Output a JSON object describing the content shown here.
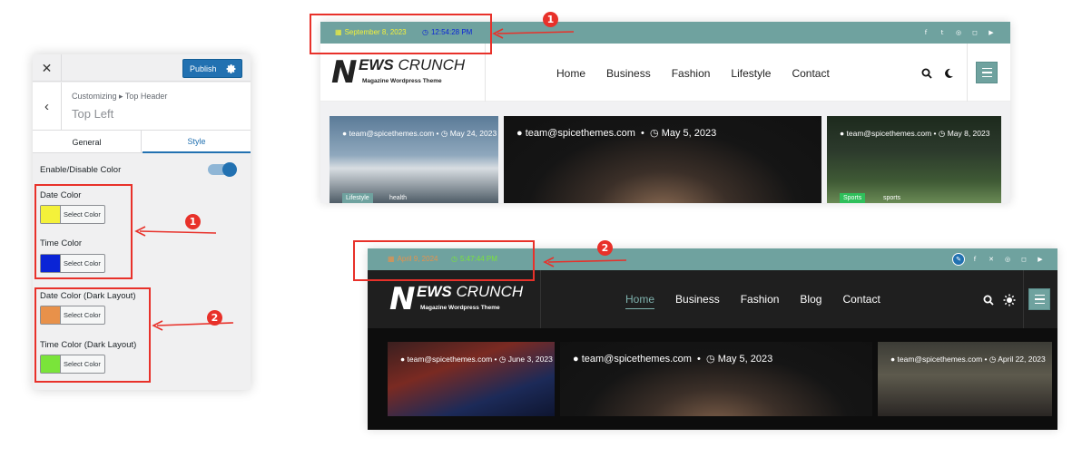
{
  "customizer": {
    "close_icon": "close-icon",
    "publish_label": "Publish",
    "settings_icon": "gear-icon",
    "back_icon": "chevron-left-icon",
    "breadcrumb": "Customizing ▸ Top Header",
    "section_title": "Top Left",
    "tabs": [
      "General",
      "Style"
    ],
    "enable_label": "Enable/Disable Color",
    "enable_on": true,
    "fields": [
      {
        "label": "Date Color",
        "color": "#f4f13a",
        "button": "Select Color"
      },
      {
        "label": "Time Color",
        "color": "#0a24d6",
        "button": "Select Color"
      },
      {
        "label": "Date Color (Dark Layout)",
        "color": "#e8914a",
        "button": "Select Color"
      },
      {
        "label": "Time Color (Dark Layout)",
        "color": "#7ae43a",
        "button": "Select Color"
      }
    ]
  },
  "callouts": {
    "one": "1",
    "two": "2",
    "accent": "#e8312a"
  },
  "light_site": {
    "date": "September 8, 2023",
    "time": "12:54:28 PM",
    "date_color": "#f4f13a",
    "time_color": "#0a24d6",
    "strip_color": "#6fa29f",
    "social_icons": [
      "facebook-icon",
      "twitter-icon",
      "dribbble-icon",
      "instagram-icon",
      "youtube-icon"
    ],
    "logo_letter": "N",
    "logo_word_bold": "EWS",
    "logo_word_light": "CRUNCH",
    "logo_tagline": "Magazine Wordpress Theme",
    "menu": [
      "Home",
      "Business",
      "Fashion",
      "Lifestyle",
      "Contact"
    ],
    "cards": [
      {
        "author": "team@spicethemes.com",
        "date": "May 24, 2023",
        "tags": [
          "Lifestyle",
          "health"
        ]
      },
      {
        "author": "team@spicethemes.com",
        "date": "May 5, 2023",
        "tags": []
      },
      {
        "author": "team@spicethemes.com",
        "date": "May 8, 2023",
        "tags": [
          "Sports",
          "sports"
        ]
      }
    ]
  },
  "dark_site": {
    "date": "April 9, 2024",
    "time": "5:47:44 PM",
    "date_color": "#e8914a",
    "time_color": "#7ae43a",
    "strip_color": "#6fa29f",
    "social_icons": [
      "edit-icon",
      "facebook-icon",
      "x-icon",
      "dribbble-icon",
      "instagram-icon",
      "youtube-icon"
    ],
    "logo_letter": "N",
    "logo_word_bold": "EWS",
    "logo_word_light": "CRUNCH",
    "logo_tagline": "Magazine Wordpress Theme",
    "menu": [
      "Home",
      "Business",
      "Fashion",
      "Blog",
      "Contact"
    ],
    "cards": [
      {
        "author": "team@spicethemes.com",
        "date": "June 3, 2023"
      },
      {
        "author": "team@spicethemes.com",
        "date": "May 5, 2023"
      },
      {
        "author": "team@spicethemes.com",
        "date": "April 22, 2023"
      }
    ]
  }
}
